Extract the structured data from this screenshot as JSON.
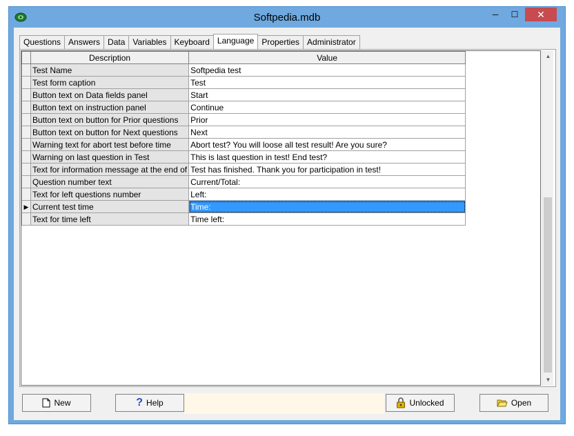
{
  "window": {
    "title": "Softpedia.mdb",
    "icon": "eye-icon",
    "close_glyph": "✕",
    "min_glyph": "─",
    "max_glyph": "☐"
  },
  "tabs": [
    {
      "label": "Questions"
    },
    {
      "label": "Answers"
    },
    {
      "label": "Data"
    },
    {
      "label": "Variables"
    },
    {
      "label": "Keyboard"
    },
    {
      "label": "Language",
      "active": true
    },
    {
      "label": "Properties"
    },
    {
      "label": "Administrator"
    }
  ],
  "grid": {
    "columns": {
      "description": "Description",
      "value": "Value"
    },
    "rows": [
      {
        "description": "Test Name",
        "value": "Softpedia test"
      },
      {
        "description": "Test form caption",
        "value": "Test"
      },
      {
        "description": "Button text on Data fields panel",
        "value": "Start"
      },
      {
        "description": "Button text on instruction panel",
        "value": "Continue"
      },
      {
        "description": "Button text on button for Prior questions",
        "value": "Prior"
      },
      {
        "description": "Button text on button for Next questions",
        "value": "Next"
      },
      {
        "description": "Warning text for abort test before time",
        "value": "Abort test? You will loose all test result! Are you sure?"
      },
      {
        "description": "Warning on last question in Test",
        "value": "This is last question in test! End test?"
      },
      {
        "description": "Text for information message at the end of",
        "value": "Test has finished. Thank you for participation in test!"
      },
      {
        "description": "Question number text",
        "value": "Current/Total:"
      },
      {
        "description": "Text for left questions number",
        "value": "Left:"
      },
      {
        "description": "Current test time",
        "value": "Time:",
        "selected": true
      },
      {
        "description": "Text for time left",
        "value": "Time left:"
      }
    ],
    "row_indicator": "▶"
  },
  "buttons": {
    "new": {
      "label": "New",
      "icon": "new-document-icon"
    },
    "help": {
      "label": "Help",
      "icon": "question-mark-icon"
    },
    "unlocked": {
      "label": "Unlocked",
      "icon": "padlock-icon"
    },
    "open": {
      "label": "Open",
      "icon": "open-folder-icon"
    }
  },
  "colors": {
    "titlebar": "#6fa9df",
    "close": "#c74b50",
    "selection": "#3399ff"
  }
}
